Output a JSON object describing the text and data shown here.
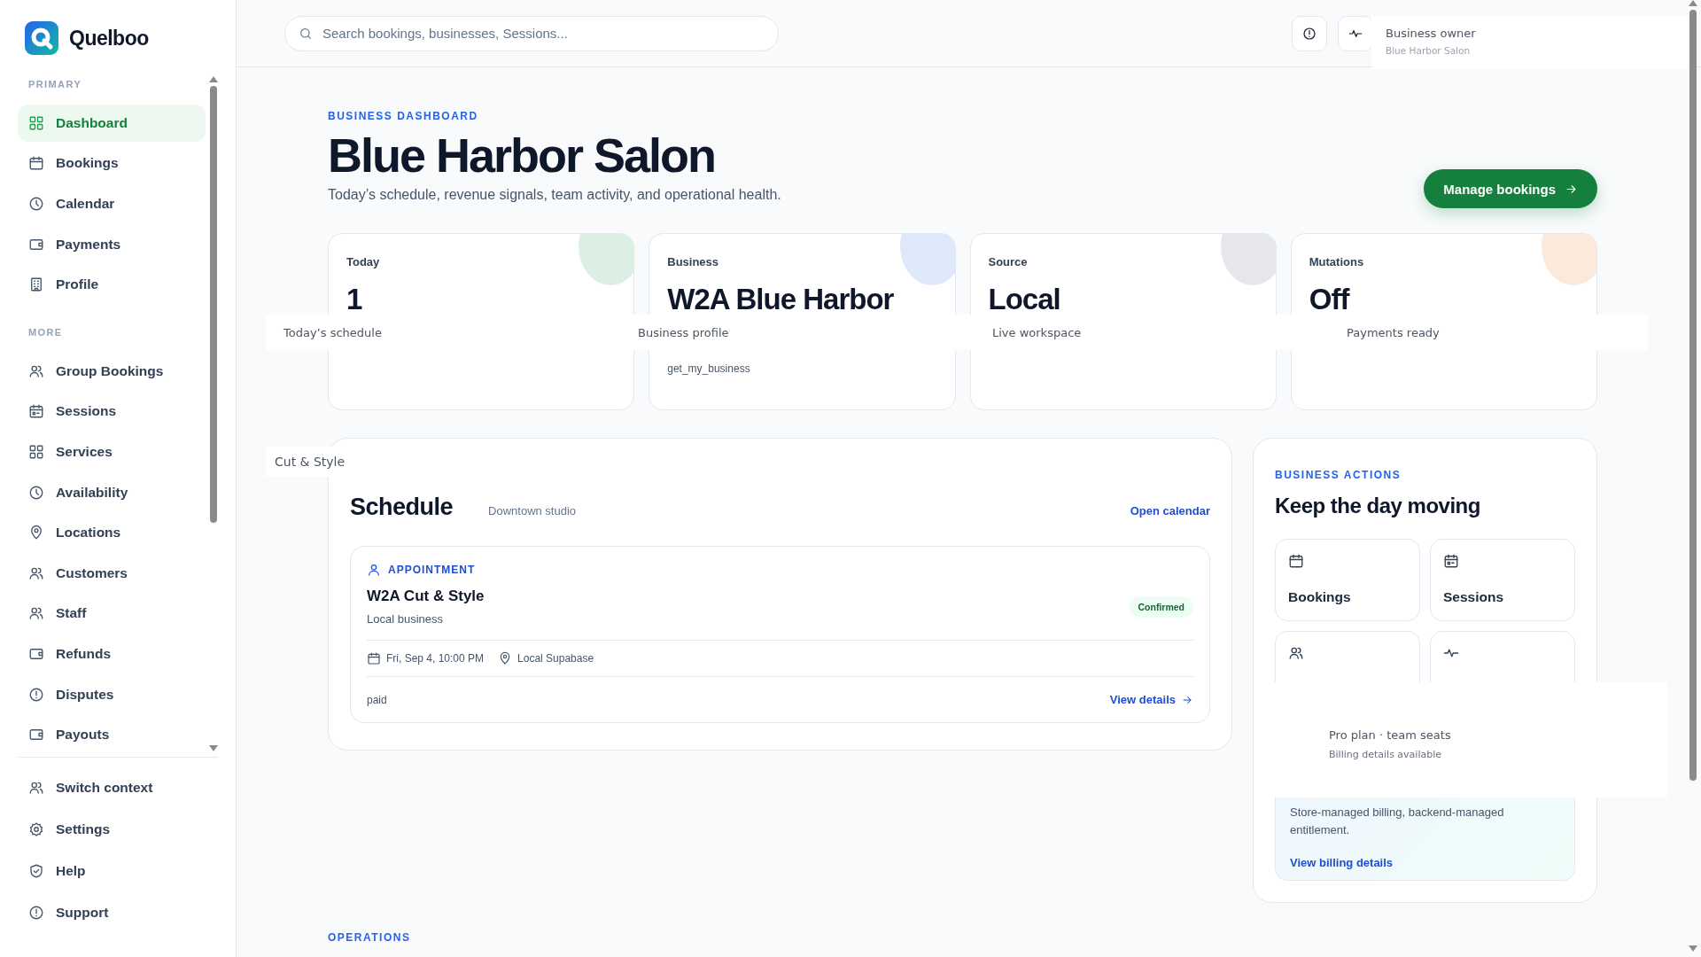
{
  "brand": {
    "name": "Quelboo"
  },
  "sidebar": {
    "sections": [
      {
        "title": "PRIMARY",
        "items": [
          {
            "label": "Dashboard",
            "selected": true
          },
          {
            "label": "Bookings",
            "selected": false
          },
          {
            "label": "Calendar",
            "selected": false
          },
          {
            "label": "Payments",
            "selected": false
          },
          {
            "label": "Profile",
            "selected": false
          }
        ]
      },
      {
        "title": "MORE",
        "items": [
          {
            "label": "Group Bookings",
            "selected": false
          },
          {
            "label": "Sessions",
            "selected": false
          },
          {
            "label": "Services",
            "selected": false
          },
          {
            "label": "Availability",
            "selected": false
          },
          {
            "label": "Locations",
            "selected": false
          },
          {
            "label": "Customers",
            "selected": false
          },
          {
            "label": "Staff",
            "selected": false
          },
          {
            "label": "Refunds",
            "selected": false
          },
          {
            "label": "Disputes",
            "selected": false
          },
          {
            "label": "Payouts",
            "selected": false
          }
        ]
      }
    ],
    "footer_items": [
      {
        "label": "Switch context"
      },
      {
        "label": "Settings"
      },
      {
        "label": "Help"
      },
      {
        "label": "Support"
      }
    ]
  },
  "header": {
    "search": {
      "placeholder": "Search bookings, businesses, Sessions..."
    },
    "user": {
      "role": "Business owner",
      "business": "Blue Harbor Salon"
    }
  },
  "hero": {
    "eyebrow": "BUSINESS DASHBOARD",
    "title": "Blue Harbor Salon",
    "subtitle": "Today’s schedule, revenue signals, team activity, and operational health.",
    "button": "Manage bookings"
  },
  "stats": [
    {
      "label": "Today",
      "value": "1",
      "color": "#dcefe4",
      "hint": "Today’s schedule"
    },
    {
      "label": "Business",
      "value": "W2A Blue Harbor",
      "note": "get_my_business",
      "color": "#dfe8fb",
      "hint": "Business profile"
    },
    {
      "label": "Source",
      "value": "Local",
      "color": "#e5e7eb",
      "hint": "Live workspace"
    },
    {
      "label": "Mutations",
      "value": "Off",
      "color": "#fbeadb",
      "hint": "Payments ready"
    }
  ],
  "schedule": {
    "tooltip": "Cut & Style",
    "title": "Schedule",
    "location": "Downtown studio",
    "link": "Open calendar",
    "appointment": {
      "type": "APPOINTMENT",
      "title": "W2A Cut & Style",
      "subtitle": "Local business",
      "status": "Confirmed",
      "date": "Fri, Sep 4, 10:00 PM",
      "place": "Local Supabase",
      "payment": "paid",
      "link": "View details"
    }
  },
  "actions": {
    "eyebrow": "BUSINESS ACTIONS",
    "title": "Keep the day moving",
    "tiles": [
      {
        "kind": "labeled",
        "label": "Bookings"
      },
      {
        "kind": "labeled",
        "label": "Sessions"
      },
      {
        "kind": "icon_only"
      },
      {
        "kind": "icon_only"
      }
    ],
    "plan": {
      "description": "Store-managed billing, backend-managed entitlement.",
      "link": "View billing details"
    },
    "tooltip": {
      "title": "Pro plan · team seats",
      "subtitle": "Billing details available"
    }
  },
  "operations": {
    "eyebrow": "OPERATIONS"
  }
}
